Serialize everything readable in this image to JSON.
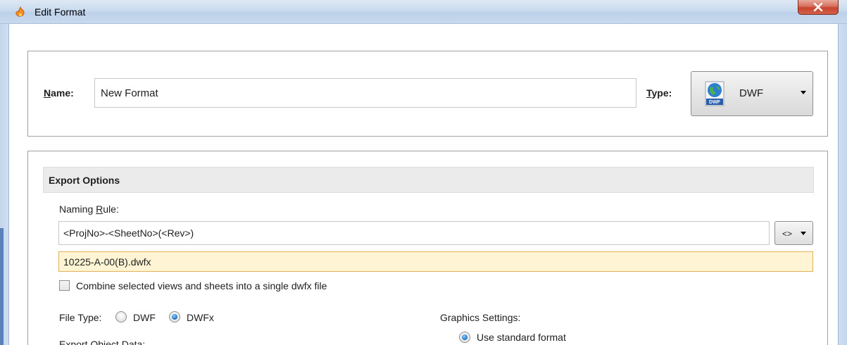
{
  "window": {
    "title": "Edit Format",
    "close_icon": "close-icon"
  },
  "header_panel": {
    "name_label_u": "N",
    "name_label_rest": "ame:",
    "name_value": "New Format",
    "type_label_u": "T",
    "type_label_rest": "ype:",
    "type_value": "DWF",
    "type_icon": "dwf-file-icon",
    "type_icon_caption": "DWF"
  },
  "export_options": {
    "section_title": "Export Options",
    "naming_rule_label_pre": "Naming ",
    "naming_rule_label_u": "R",
    "naming_rule_label_post": "ule:",
    "naming_rule_value": "<ProjNo>-<SheetNo>(<Rev>)",
    "macro_button_label": "<>",
    "preview_value": "10225-A-00(B).dwfx",
    "combine_checkbox_label": "Combine selected views and sheets into a single dwfx file",
    "combine_checked": false,
    "file_type_label": "File Type:",
    "file_type_options": [
      "DWF",
      "DWFx"
    ],
    "file_type_selected": "DWFx",
    "export_object_data_label": "Export Object Data:",
    "graphics_settings_label": "Graphics Settings:",
    "graphics_option_label": "Use standard format",
    "graphics_option_selected": true
  },
  "colors": {
    "preview_bg": "#fff4d4",
    "preview_border": "#e0b25a",
    "title_bar": "#c9dbee",
    "close_button": "#c7452f"
  }
}
